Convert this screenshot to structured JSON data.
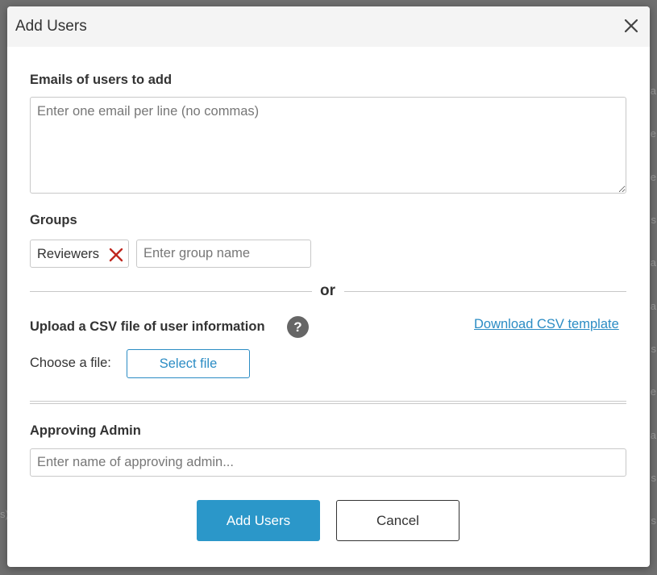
{
  "dialog": {
    "title": "Add Users",
    "close_icon": "close-icon"
  },
  "emails": {
    "label": "Emails of users to add",
    "placeholder": "Enter one email per line (no commas)",
    "value": ""
  },
  "groups": {
    "label": "Groups",
    "chips": [
      {
        "label": "Reviewers",
        "remove_icon": "remove-x-icon"
      }
    ],
    "input_placeholder": "Enter group name"
  },
  "divider": {
    "text": "or"
  },
  "csv": {
    "label": "Upload a CSV file of user information",
    "help_icon": "question-mark-icon",
    "help_glyph": "?",
    "template_link": "Download CSV template",
    "choose_label": "Choose a file:",
    "select_button": "Select file"
  },
  "approver": {
    "label": "Approving Admin",
    "placeholder": "Enter name of approving admin..."
  },
  "actions": {
    "primary": "Add Users",
    "secondary": "Cancel"
  },
  "colors": {
    "accent": "#2b97c9",
    "link": "#2b8cc4",
    "remove_x": "#c0271e",
    "header_bg": "#f4f4f4",
    "backdrop": "#6f6f6f"
  }
}
